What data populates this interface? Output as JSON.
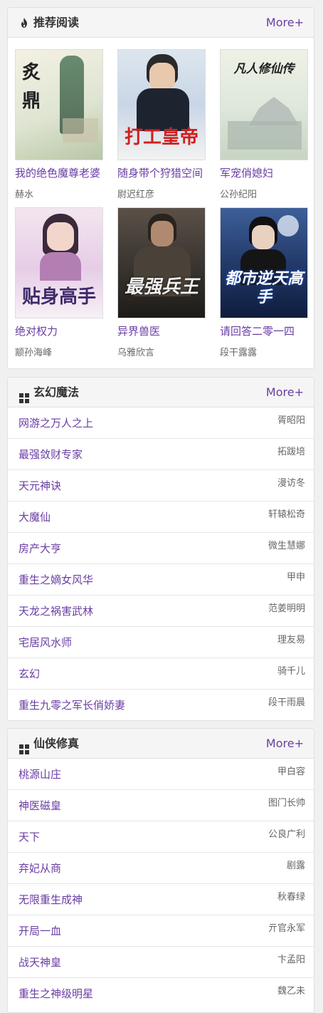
{
  "recommend": {
    "title": "推荐阅读",
    "more": "More+",
    "books": [
      {
        "title": "我的绝色魔尊老婆",
        "author": "赫水",
        "cover_text": "炙鼎",
        "cover_bg": "#dfe5d2"
      },
      {
        "title": "随身带个狩猎空间",
        "author": "尉迟红彦",
        "cover_text": "打工皇帝",
        "cover_bg": "#c9d6e6"
      },
      {
        "title": "军宠俏媳妇",
        "author": "公孙纪阳",
        "cover_text": "凡人修仙传",
        "cover_bg": "#dfe8dc"
      },
      {
        "title": "绝对权力",
        "author": "颛孙海峰",
        "cover_text": "贴身高手",
        "cover_bg": "#e6cde6"
      },
      {
        "title": "异界兽医",
        "author": "乌雅欣言",
        "cover_text": "最强兵王",
        "cover_bg": "#3b3631"
      },
      {
        "title": "请回答二零一四",
        "author": "段干露露",
        "cover_text": "都市逆天高手",
        "cover_bg": "#233a6a"
      }
    ]
  },
  "xuanhuan": {
    "title": "玄幻魔法",
    "more": "More+",
    "items": [
      {
        "title": "网游之万人之上",
        "author": "胥昭阳"
      },
      {
        "title": "最强敛财专家",
        "author": "拓跋培"
      },
      {
        "title": "天元神诀",
        "author": "漫访冬"
      },
      {
        "title": "大魔仙",
        "author": "轩辕松奇"
      },
      {
        "title": "房产大亨",
        "author": "微生慧娜"
      },
      {
        "title": "重生之嫡女风华",
        "author": "甲申"
      },
      {
        "title": "天龙之祸害武林",
        "author": "范姜明明"
      },
      {
        "title": "宅居风水师",
        "author": "理友易"
      },
      {
        "title": "玄幻",
        "author": "骑千儿"
      },
      {
        "title": "重生九零之军长俏娇妻",
        "author": "段干雨晨"
      }
    ]
  },
  "xianxia": {
    "title": "仙侠修真",
    "more": "More+",
    "items": [
      {
        "title": "桃源山庄",
        "author": "甲白容"
      },
      {
        "title": "神医磁皇",
        "author": "图门长帅"
      },
      {
        "title": "天下",
        "author": "公良广利"
      },
      {
        "title": "弃妃从商",
        "author": "剧露"
      },
      {
        "title": "无限重生成神",
        "author": "秋春绿"
      },
      {
        "title": "开局一血",
        "author": "亓官永军"
      },
      {
        "title": "战天神皇",
        "author": "卞孟阳"
      },
      {
        "title": "重生之神级明星",
        "author": "魏乙未"
      }
    ]
  }
}
